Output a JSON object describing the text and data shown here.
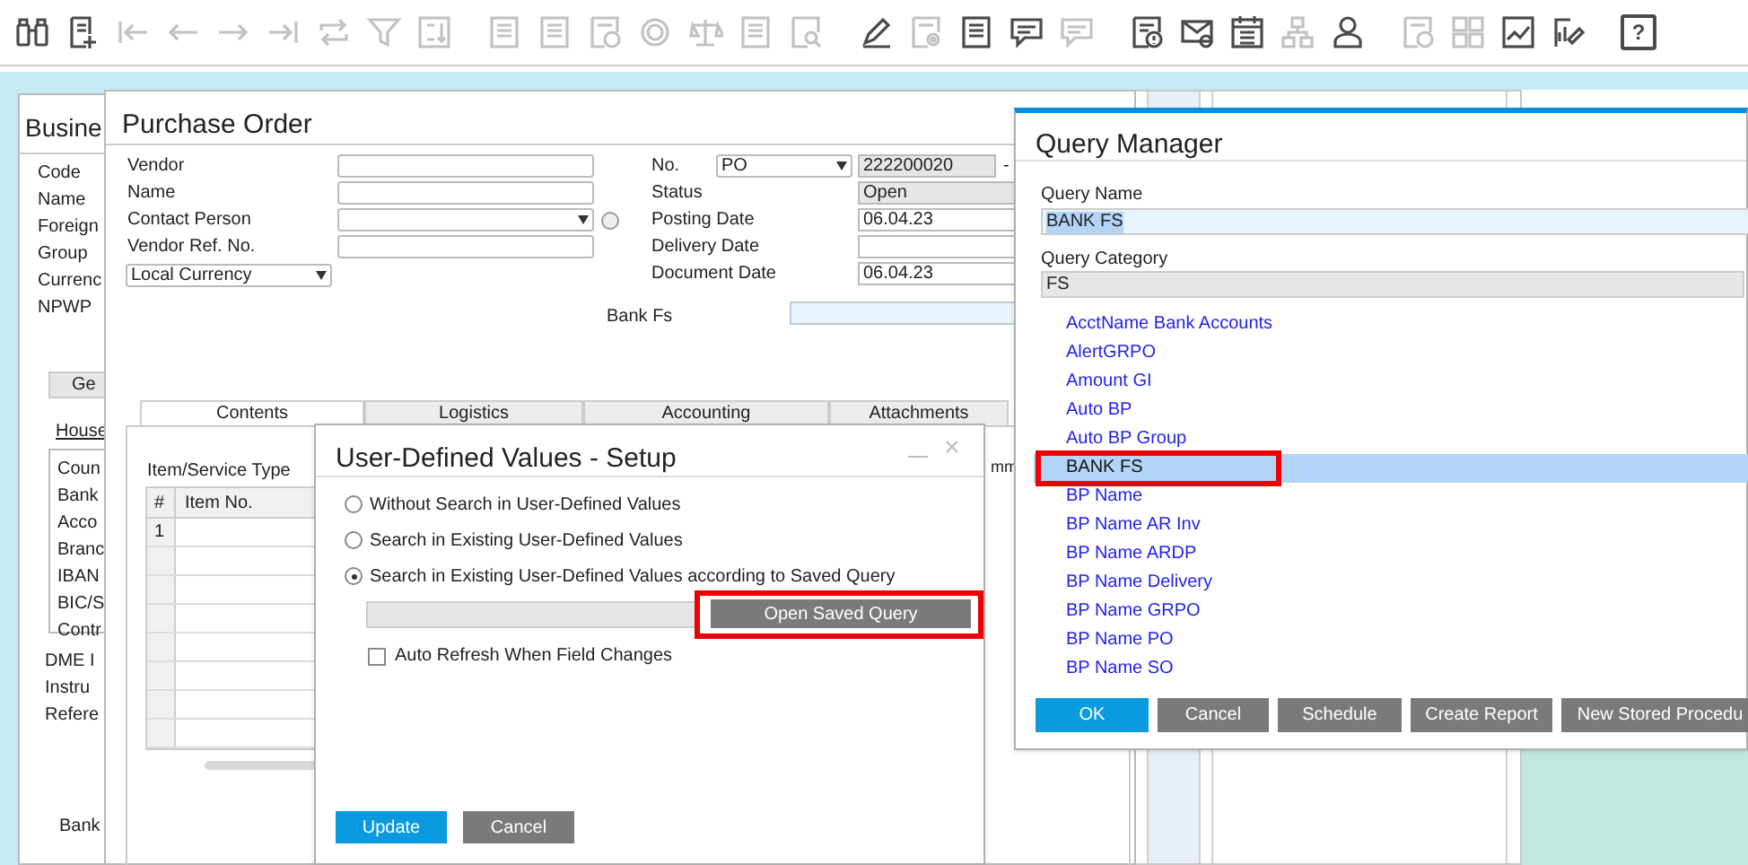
{
  "toolbar": {
    "groups": [
      [
        {
          "kind": "binoculars",
          "disabled": false
        },
        {
          "kind": "document-plus",
          "disabled": false
        },
        {
          "kind": "arrow-first",
          "disabled": true
        },
        {
          "kind": "arrow-left",
          "disabled": true
        },
        {
          "kind": "arrow-right",
          "disabled": true
        },
        {
          "kind": "arrow-last",
          "disabled": true
        },
        {
          "kind": "swap",
          "disabled": true
        },
        {
          "kind": "filter",
          "disabled": true
        },
        {
          "kind": "sort",
          "disabled": true
        }
      ],
      [
        {
          "kind": "document",
          "disabled": true
        },
        {
          "kind": "document",
          "disabled": true
        },
        {
          "kind": "document-coin",
          "disabled": true
        },
        {
          "kind": "coin",
          "disabled": true
        },
        {
          "kind": "scale",
          "disabled": true
        },
        {
          "kind": "document",
          "disabled": true
        },
        {
          "kind": "document-search",
          "disabled": true
        }
      ],
      [
        {
          "kind": "pencil",
          "disabled": false
        },
        {
          "kind": "document-gear",
          "disabled": true
        },
        {
          "kind": "document",
          "disabled": false
        },
        {
          "kind": "chat",
          "disabled": false
        },
        {
          "kind": "chat",
          "disabled": true
        }
      ],
      [
        {
          "kind": "document-alert",
          "disabled": false
        },
        {
          "kind": "mail",
          "disabled": false
        },
        {
          "kind": "calendar",
          "disabled": false
        },
        {
          "kind": "tree",
          "disabled": true
        },
        {
          "kind": "person",
          "disabled": false
        }
      ],
      [
        {
          "kind": "document-coin",
          "disabled": true
        },
        {
          "kind": "grid",
          "disabled": true
        },
        {
          "kind": "chart",
          "disabled": false
        },
        {
          "kind": "pencil-chart",
          "disabled": false
        }
      ],
      [
        {
          "kind": "help",
          "label": "?",
          "disabled": false
        }
      ]
    ]
  },
  "business_partner": {
    "title": "Busine",
    "fields": [
      "Code",
      "Name",
      "Foreign",
      "Group",
      "Currenc",
      "NPWP"
    ],
    "tab": "Ge",
    "section": "House",
    "list": [
      "Coun",
      "Bank",
      "Acco",
      "Branc",
      "IBAN",
      "BIC/S",
      "Contr"
    ],
    "extra": [
      "DME I",
      "Instru",
      "Refere"
    ],
    "footer": "Bank"
  },
  "purchase_order": {
    "title": "Purchase Order",
    "left_fields": [
      {
        "label": "Vendor",
        "kind": "text"
      },
      {
        "label": "Name",
        "kind": "text"
      },
      {
        "label": "Contact Person",
        "kind": "dropdown"
      },
      {
        "label": "Vendor Ref. No.",
        "kind": "text"
      }
    ],
    "currency": "Local Currency",
    "right_fields": [
      {
        "label": "No.",
        "kind": "number",
        "series": "PO",
        "value": "222200020",
        "suffix": "-"
      },
      {
        "label": "Status",
        "kind": "readonly",
        "value": "Open"
      },
      {
        "label": "Posting Date",
        "kind": "text",
        "value": "06.04.23"
      },
      {
        "label": "Delivery Date",
        "kind": "text"
      },
      {
        "label": "Document Date",
        "kind": "text",
        "value": "06.04.23"
      }
    ],
    "bank_fs": {
      "label": "Bank Fs"
    },
    "tabs": [
      {
        "label": "Contents",
        "selected": true
      },
      {
        "label": "Logistics",
        "selected": false
      },
      {
        "label": "Accounting",
        "selected": false
      },
      {
        "label": "Attachments",
        "selected": false
      }
    ],
    "item_type_label": "Item/Service Type",
    "table": {
      "columns": [
        "#",
        "Item No."
      ],
      "rows": [
        {
          "number": "1"
        }
      ],
      "column_3": "mm"
    }
  },
  "udv_dialog": {
    "title": "User-Defined Values - Setup",
    "close_label": "×",
    "options": [
      {
        "label": "Without Search in User-Defined Values",
        "selected": false
      },
      {
        "label": "Search in Existing User-Defined Values",
        "selected": false
      },
      {
        "label": "Search in Existing User-Defined Values according to Saved Query",
        "selected": true
      }
    ],
    "query_button": {
      "label": "Open Saved Query",
      "highlighted": true
    },
    "auto_refresh": {
      "label": "Auto Refresh When Field Changes",
      "checked": false
    },
    "buttons": [
      {
        "label": "Update",
        "kind": "primary"
      },
      {
        "label": "Cancel",
        "kind": "secondary"
      }
    ]
  },
  "query_manager": {
    "title": "Query Manager",
    "name_label": "Query Name",
    "name_value": "BANK FS",
    "category_label": "Query Category",
    "category_value": "FS",
    "items": [
      {
        "label": "AcctName Bank Accounts",
        "selected": false
      },
      {
        "label": "AlertGRPO",
        "selected": false
      },
      {
        "label": "Amount GI",
        "selected": false
      },
      {
        "label": "Auto BP",
        "selected": false
      },
      {
        "label": "Auto BP Group",
        "selected": false
      },
      {
        "label": "BANK FS",
        "selected": true
      },
      {
        "label": "BP Name",
        "selected": false
      },
      {
        "label": "BP Name AR Inv",
        "selected": false
      },
      {
        "label": "BP Name ARDP",
        "selected": false
      },
      {
        "label": "BP Name Delivery",
        "selected": false
      },
      {
        "label": "BP Name GRPO",
        "selected": false
      },
      {
        "label": "BP Name PO",
        "selected": false
      },
      {
        "label": "BP Name SO",
        "selected": false
      }
    ],
    "buttons": [
      {
        "label": "OK",
        "kind": "primary"
      },
      {
        "label": "Cancel",
        "kind": "secondary"
      },
      {
        "label": "Schedule",
        "kind": "secondary"
      },
      {
        "label": "Create Report",
        "kind": "secondary"
      },
      {
        "label": "New Stored Procedu",
        "kind": "secondary"
      }
    ]
  }
}
